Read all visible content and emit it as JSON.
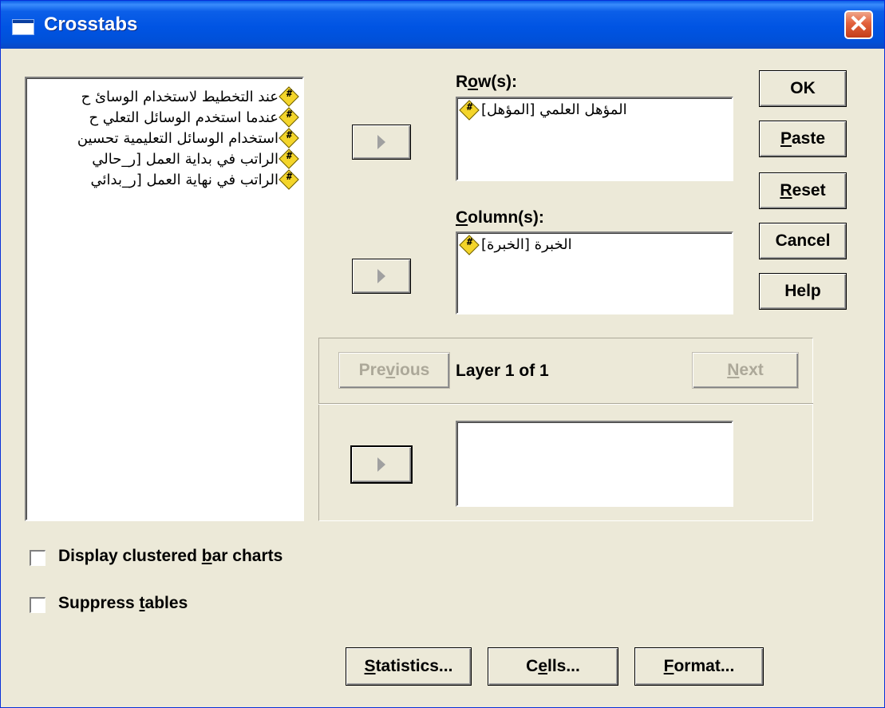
{
  "window": {
    "title": "Crosstabs"
  },
  "variables": {
    "items": [
      "عند التخطيط لاستخدام الوسائ ح",
      "عندما استخدم الوسائل التعلي ح",
      "استخدام الوسائل التعليمية تحسين",
      "الراتب في بداية العمل [ر_حالي",
      "الراتب في نهاية العمل [ر_بدائي"
    ]
  },
  "rows": {
    "label_pre": "R",
    "label_u": "o",
    "label_post": "w(s):",
    "value": "المؤهل العلمي [المؤهل]"
  },
  "columns": {
    "label_pre": "",
    "label_u": "C",
    "label_post": "olumn(s):",
    "value": "الخبرة [الخبرة]"
  },
  "layer": {
    "previous_pre": "Pre",
    "previous_u": "v",
    "previous_post": "ious",
    "text": "Layer 1 of 1",
    "next_pre": "",
    "next_u": "N",
    "next_post": "ext"
  },
  "side_buttons": {
    "ok": "OK",
    "paste_u": "P",
    "paste_post": "aste",
    "reset_u": "R",
    "reset_post": "eset",
    "cancel": "Cancel",
    "help": "Help"
  },
  "options": {
    "clustered_pre": "Display clustered ",
    "clustered_u": "b",
    "clustered_post": "ar charts",
    "suppress_pre": "Suppress ",
    "suppress_u": "t",
    "suppress_post": "ables"
  },
  "bottom_buttons": {
    "statistics_u": "S",
    "statistics_post": "tatistics...",
    "cells_pre": "C",
    "cells_u": "e",
    "cells_post": "lls...",
    "format_u": "F",
    "format_post": "ormat..."
  },
  "colors": {
    "titlebar": "#0054e3",
    "dialog_bg": "#ece9d8",
    "close": "#e2613c"
  },
  "icons": [
    "window-icon",
    "close-icon",
    "numeric-variable-icon",
    "arrow-right-icon",
    "checkbox-icon"
  ]
}
